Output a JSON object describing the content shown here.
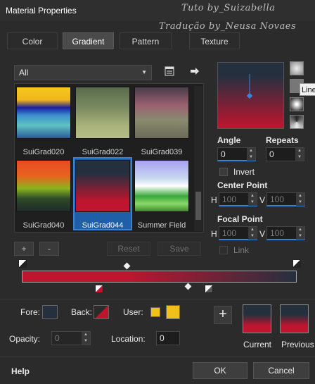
{
  "window": {
    "title": "Material Properties"
  },
  "watermark": {
    "line1": "Tuto by_Suizabella",
    "line2": "Tradução by_Neusa Novaes"
  },
  "tabs": [
    {
      "label": "Color",
      "active": false
    },
    {
      "label": "Gradient",
      "active": true
    },
    {
      "label": "Pattern",
      "active": false
    },
    {
      "label": "Texture",
      "active": false
    }
  ],
  "library": {
    "category": "All"
  },
  "swatches": [
    {
      "name": "SuiGrad020"
    },
    {
      "name": "SuiGrad022"
    },
    {
      "name": "SuiGrad039"
    },
    {
      "name": "SuiGrad040"
    },
    {
      "name": "SuiGrad044",
      "selected": true
    },
    {
      "name": "Summer Field"
    }
  ],
  "buttons": {
    "add": "+",
    "remove": "-",
    "reset": "Reset",
    "save": "Save"
  },
  "tooltip": {
    "text": "Line"
  },
  "fields": {
    "angle_label": "Angle",
    "angle_value": "0",
    "repeats_label": "Repeats",
    "repeats_value": "0",
    "invert_label": "Invert",
    "center_label": "Center Point",
    "center_h_label": "H",
    "center_h": "100",
    "center_v_label": "V",
    "center_v": "100",
    "focal_label": "Focal Point",
    "focal_h_label": "H",
    "focal_h": "100",
    "focal_v_label": "V",
    "focal_v": "100",
    "link_label": "Link"
  },
  "colors": {
    "fore_label": "Fore:",
    "back_label": "Back:",
    "user_label": "User:",
    "opacity_label": "Opacity:",
    "opacity_value": "0",
    "location_label": "Location:",
    "location_value": "0",
    "fore_color": "#25303f",
    "user_color": "#f2c01a",
    "accent": "#c0152f"
  },
  "preview": {
    "current_label": "Current",
    "previous_label": "Previous"
  },
  "footer": {
    "help": "Help",
    "ok": "OK",
    "cancel": "Cancel"
  }
}
